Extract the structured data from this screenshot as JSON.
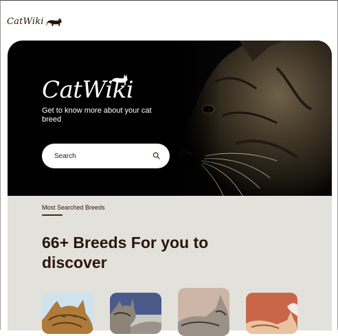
{
  "header": {
    "brand": "CatWiki",
    "cat_icon": "cat-silhouette-icon"
  },
  "hero": {
    "logo": "CatWiki",
    "tagline": "Get to know more about your cat breed",
    "search": {
      "placeholder": "Search",
      "value": "",
      "icon": "search-icon"
    }
  },
  "breeds_section": {
    "kicker": "Most Searched Breeds",
    "headline": "66+ Breeds For you to discover"
  },
  "colors": {
    "brand": "#291507",
    "hero_bg": "#000000",
    "section_bg": "#e3e1dc",
    "accent_line": "#4d270c"
  }
}
